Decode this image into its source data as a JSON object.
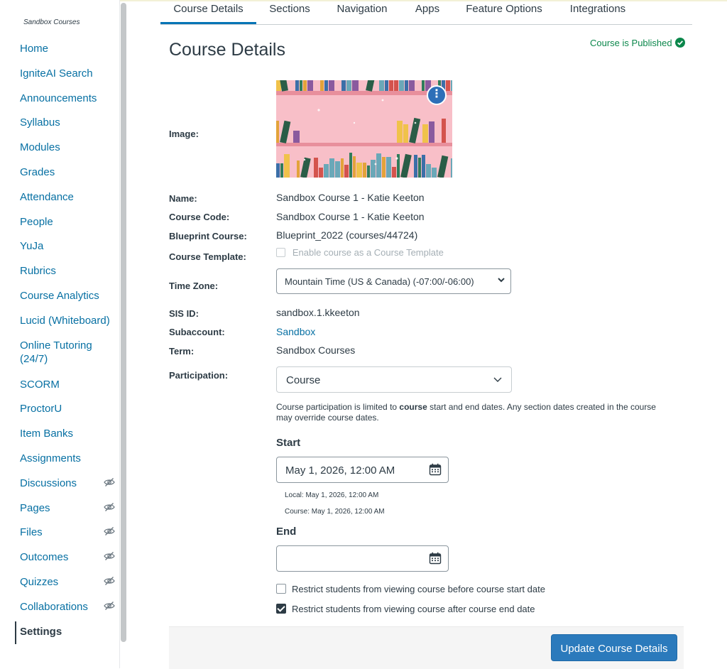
{
  "sidebar": {
    "context": "Sandbox Courses",
    "items": [
      {
        "label": "Home"
      },
      {
        "label": "IgniteAI Search"
      },
      {
        "label": "Announcements"
      },
      {
        "label": "Syllabus"
      },
      {
        "label": "Modules"
      },
      {
        "label": "Grades"
      },
      {
        "label": "Attendance"
      },
      {
        "label": "People"
      },
      {
        "label": "YuJa"
      },
      {
        "label": "Rubrics"
      },
      {
        "label": "Course Analytics"
      },
      {
        "label": "Lucid (Whiteboard)"
      },
      {
        "label": "Online Tutoring (24/7)"
      },
      {
        "label": "SCORM"
      },
      {
        "label": "ProctorU"
      },
      {
        "label": "Item Banks"
      },
      {
        "label": "Assignments"
      },
      {
        "label": "Discussions",
        "hidden_icon": "eye-slash-icon"
      },
      {
        "label": "Pages",
        "hidden_icon": "eye-slash-icon"
      },
      {
        "label": "Files",
        "hidden_icon": "eye-slash-icon"
      },
      {
        "label": "Outcomes",
        "hidden_icon": "eye-slash-icon"
      },
      {
        "label": "Quizzes",
        "hidden_icon": "eye-slash-icon"
      },
      {
        "label": "Collaborations",
        "hidden_icon": "eye-slash-icon"
      },
      {
        "label": "Settings",
        "active": true
      }
    ]
  },
  "tabs": [
    {
      "label": "Course Details",
      "active": true
    },
    {
      "label": "Sections"
    },
    {
      "label": "Navigation"
    },
    {
      "label": "Apps"
    },
    {
      "label": "Feature Options"
    },
    {
      "label": "Integrations"
    }
  ],
  "page": {
    "title": "Course Details",
    "status": "Course is Published",
    "status_color": "#0b874b"
  },
  "details": {
    "image_label": "Image:",
    "name_label": "Name:",
    "name": "Sandbox Course 1 - Katie Keeton",
    "code_label": "Course Code:",
    "code": "Sandbox Course 1 - Katie Keeton",
    "blueprint_label": "Blueprint Course:",
    "blueprint": "Blueprint_2022 (courses/44724)",
    "template_label": "Course Template:",
    "template_option": "Enable course as a Course Template",
    "timezone_label": "Time Zone:",
    "timezone": "Mountain Time (US & Canada) (-07:00/-06:00)",
    "sis_label": "SIS ID:",
    "sis": "sandbox.1.kkeeton",
    "subaccount_label": "Subaccount:",
    "subaccount": "Sandbox",
    "term_label": "Term:",
    "term": "Sandbox Courses",
    "participation_label": "Participation:",
    "participation": "Course",
    "note_pre": "Course participation is limited to ",
    "note_bold": "course",
    "note_post": " start and end dates. Any section dates created in the course may override course dates.",
    "start_label": "Start",
    "start_value": "May 1, 2026, 12:00 AM",
    "start_local": "Local: May 1, 2026, 12:00 AM",
    "start_course": "Course: May 1, 2026, 12:00 AM",
    "end_label": "End",
    "end_value": "",
    "restrict_before": "Restrict students from viewing course before course start date",
    "restrict_before_checked": false,
    "restrict_after": "Restrict students from viewing course after course end date",
    "restrict_after_checked": true
  },
  "actions": {
    "update_label": "Update Course Details"
  },
  "colors": {
    "link": "#0770a3",
    "primary_button": "#2b7abc",
    "image_background": "#f8bfc8"
  }
}
